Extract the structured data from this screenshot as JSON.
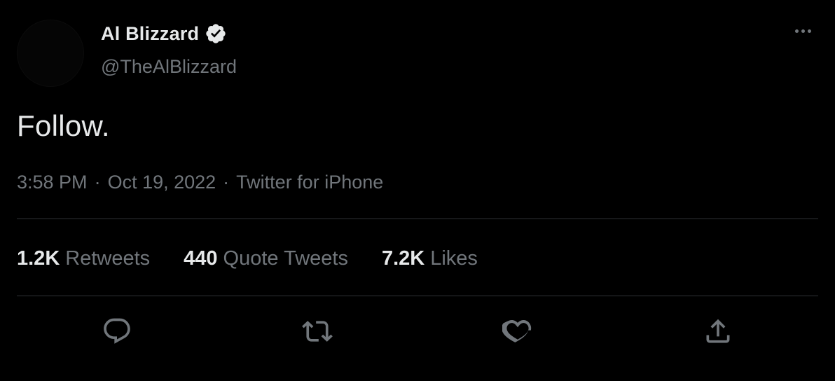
{
  "tweet": {
    "author": {
      "display_name": "Al Blizzard",
      "handle": "@TheAlBlizzard",
      "verified": true
    },
    "text": "Follow.",
    "time": "3:58 PM",
    "date": "Oct 19, 2022",
    "source": "Twitter for iPhone",
    "separator": "·"
  },
  "stats": {
    "retweets_count": "1.2K",
    "retweets_label": "Retweets",
    "quotes_count": "440",
    "quotes_label": "Quote Tweets",
    "likes_count": "7.2K",
    "likes_label": "Likes"
  },
  "icons": {
    "verified": "verified-badge-icon",
    "more": "more-options-icon",
    "reply": "reply-icon",
    "retweet": "retweet-icon",
    "like": "heart-icon",
    "share": "share-icon"
  },
  "colors": {
    "background": "#000000",
    "primary_text": "#e7e9ea",
    "secondary_text": "#71767b",
    "divider": "#2f3336"
  }
}
